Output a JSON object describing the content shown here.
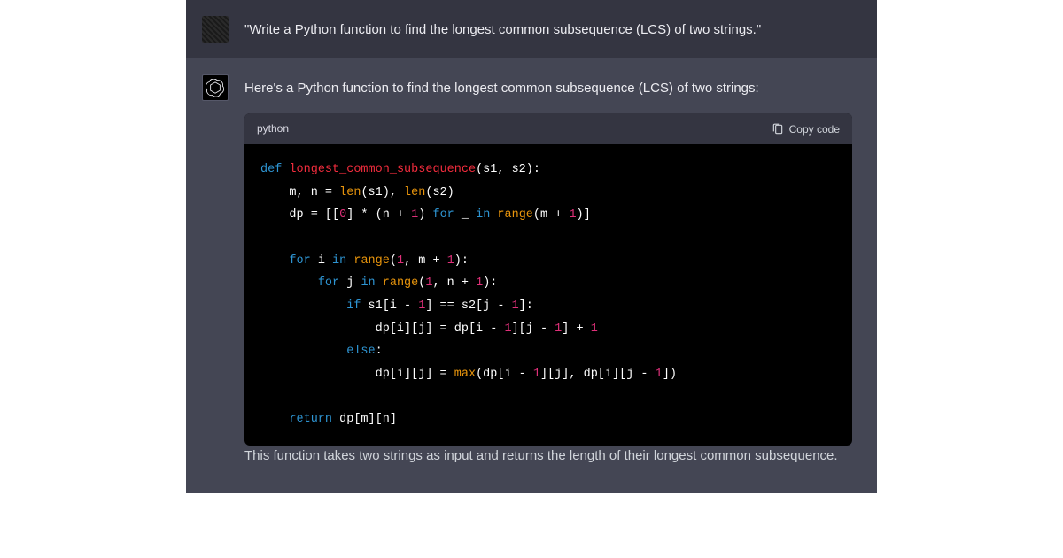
{
  "user": {
    "message": "\"Write a Python function to find the longest common subsequence (LCS) of two strings.\""
  },
  "assistant": {
    "intro": "Here's a Python function to find the longest common subsequence (LCS) of two strings:",
    "code": {
      "language": "python",
      "copy_label": "Copy code",
      "tokens": {
        "def": "def",
        "fn_name": "longest_common_subsequence",
        "params": "(s1, s2):",
        "line2a": "    m, n = ",
        "len": "len",
        "line2b": "(s1), ",
        "line2c": "(s2)",
        "line3a": "    dp = [[",
        "zero": "0",
        "line3b": "] * (n + ",
        "one": "1",
        "line3c": ") ",
        "for": "for",
        "line3d": " _ ",
        "in": "in",
        "space": " ",
        "range": "range",
        "line3e": "(m + ",
        "line3f": ")]",
        "line5a": "    ",
        "line5b": " i ",
        "line5c": "(",
        "line5d": ", m + ",
        "line5e": "):",
        "line6a": "        ",
        "line6b": " j ",
        "line6c": ", n + ",
        "line7a": "            ",
        "if": "if",
        "line7b": " s1[i - ",
        "line7c": "] == s2[j - ",
        "line7d": "]:",
        "line8a": "                dp[i][j] = dp[i - ",
        "line8b": "][j - ",
        "line8c": "] + ",
        "line9a": "            ",
        "else": "else",
        "colon": ":",
        "line10a": "                dp[i][j] = ",
        "max": "max",
        "line10b": "(dp[i - ",
        "line10c": "][j], dp[i][j - ",
        "line10d": "])",
        "return": "return",
        "line12a": "    ",
        "line12b": " dp[m][n]"
      }
    },
    "follow": "This function takes two strings as input and returns the length of their longest common subsequence."
  }
}
